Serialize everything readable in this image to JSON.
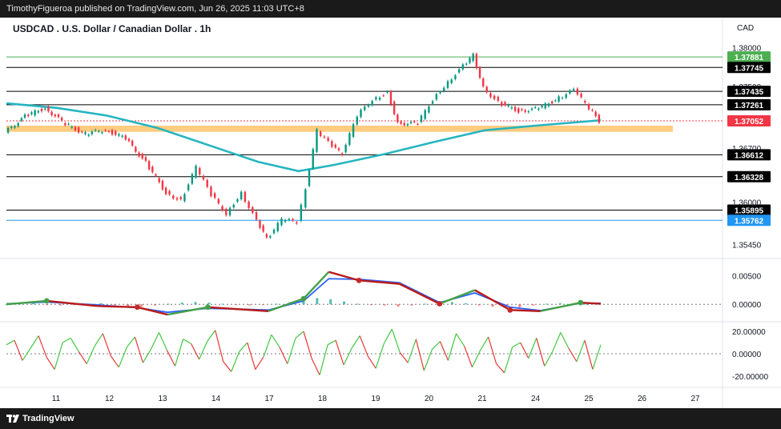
{
  "header": {
    "publisher_line": "TimothyFigueroa published on TradingView.com, Jun 26, 2025 11:03 UTC+8"
  },
  "footer": {
    "brand": "TradingView",
    "logo_icon": "tradingview-logo-icon"
  },
  "chart_data": {
    "type": "line",
    "title": "USDCAD . U.S. Dollar / Canadian Dollar . 1h",
    "currency": "CAD",
    "x_ticks": [
      "11",
      "12",
      "13",
      "14",
      "17",
      "18",
      "19",
      "20",
      "21",
      "24",
      "25",
      "26",
      "27"
    ],
    "price_axis": {
      "ticks": [
        "1.38000",
        "1.37500",
        "1.36700",
        "1.36000",
        "1.35450"
      ],
      "ylim": [
        1.3536,
        1.3808
      ]
    },
    "levels": [
      {
        "label": "1.37881",
        "value": 1.37881,
        "color": "#4caf50"
      },
      {
        "label": "1.37745",
        "value": 1.37745,
        "color": "#000000"
      },
      {
        "label": "1.37435",
        "value": 1.37435,
        "color": "#000000"
      },
      {
        "label": "1.37261",
        "value": 1.37261,
        "color": "#000000"
      },
      {
        "label": "1.37052",
        "value": 1.37052,
        "color": "#f23645"
      },
      {
        "label": "1.36612",
        "value": 1.36612,
        "color": "#000000"
      },
      {
        "label": "1.36328",
        "value": 1.36328,
        "color": "#000000"
      },
      {
        "label": "1.35895",
        "value": 1.35895,
        "color": "#000000"
      },
      {
        "label": "1.35762",
        "value": 1.35762,
        "color": "#2196f3"
      }
    ],
    "zone": {
      "from": 1.3691,
      "to": 1.3699,
      "color": "#ffcc80"
    },
    "price_series": [
      {
        "x": 0,
        "y": 1.369
      },
      {
        "x": 8,
        "y": 1.3711
      },
      {
        "x": 16,
        "y": 1.3722
      },
      {
        "x": 24,
        "y": 1.3701
      },
      {
        "x": 32,
        "y": 1.3688
      },
      {
        "x": 40,
        "y": 1.3694
      },
      {
        "x": 48,
        "y": 1.3682
      },
      {
        "x": 56,
        "y": 1.3651
      },
      {
        "x": 64,
        "y": 1.3612
      },
      {
        "x": 70,
        "y": 1.3602
      },
      {
        "x": 76,
        "y": 1.3645
      },
      {
        "x": 82,
        "y": 1.3609
      },
      {
        "x": 88,
        "y": 1.3585
      },
      {
        "x": 94,
        "y": 1.3612
      },
      {
        "x": 100,
        "y": 1.3575
      },
      {
        "x": 104,
        "y": 1.3552
      },
      {
        "x": 110,
        "y": 1.3577
      },
      {
        "x": 116,
        "y": 1.3574
      },
      {
        "x": 118,
        "y": 1.3594
      },
      {
        "x": 124,
        "y": 1.3692
      },
      {
        "x": 130,
        "y": 1.3672
      },
      {
        "x": 134,
        "y": 1.3662
      },
      {
        "x": 140,
        "y": 1.3712
      },
      {
        "x": 146,
        "y": 1.3733
      },
      {
        "x": 152,
        "y": 1.3742
      },
      {
        "x": 156,
        "y": 1.3702
      },
      {
        "x": 164,
        "y": 1.3702
      },
      {
        "x": 170,
        "y": 1.3733
      },
      {
        "x": 176,
        "y": 1.3756
      },
      {
        "x": 182,
        "y": 1.3776
      },
      {
        "x": 186,
        "y": 1.379
      },
      {
        "x": 190,
        "y": 1.3748
      },
      {
        "x": 196,
        "y": 1.3729
      },
      {
        "x": 204,
        "y": 1.3718
      },
      {
        "x": 212,
        "y": 1.3721
      },
      {
        "x": 220,
        "y": 1.3735
      },
      {
        "x": 226,
        "y": 1.3745
      },
      {
        "x": 232,
        "y": 1.3722
      },
      {
        "x": 236,
        "y": 1.3705
      }
    ],
    "moving_average": [
      {
        "x": 0,
        "y": 1.3728
      },
      {
        "x": 20,
        "y": 1.3722
      },
      {
        "x": 40,
        "y": 1.3712
      },
      {
        "x": 60,
        "y": 1.3696
      },
      {
        "x": 80,
        "y": 1.3674
      },
      {
        "x": 100,
        "y": 1.3652
      },
      {
        "x": 116,
        "y": 1.364
      },
      {
        "x": 130,
        "y": 1.3648
      },
      {
        "x": 150,
        "y": 1.3662
      },
      {
        "x": 170,
        "y": 1.3678
      },
      {
        "x": 190,
        "y": 1.3693
      },
      {
        "x": 210,
        "y": 1.3699
      },
      {
        "x": 236,
        "y": 1.3706
      }
    ],
    "macd_panel": {
      "ticks": [
        "0.00500",
        "0.00000"
      ],
      "ylim": [
        -0.0025,
        0.0065
      ],
      "macd": [
        {
          "x": 0,
          "y": 0.0
        },
        {
          "x": 16,
          "y": 0.0006
        },
        {
          "x": 36,
          "y": -0.0003
        },
        {
          "x": 52,
          "y": -0.0005
        },
        {
          "x": 64,
          "y": -0.0018
        },
        {
          "x": 80,
          "y": -0.0005
        },
        {
          "x": 104,
          "y": -0.0012
        },
        {
          "x": 118,
          "y": 0.001
        },
        {
          "x": 128,
          "y": 0.0057
        },
        {
          "x": 140,
          "y": 0.0042
        },
        {
          "x": 156,
          "y": 0.0036
        },
        {
          "x": 172,
          "y": 0.0001
        },
        {
          "x": 186,
          "y": 0.0025
        },
        {
          "x": 200,
          "y": -0.001
        },
        {
          "x": 212,
          "y": -0.0012
        },
        {
          "x": 228,
          "y": 0.0003
        },
        {
          "x": 236,
          "y": 0.0001
        }
      ],
      "signal": [
        {
          "x": 0,
          "y": 0.0001
        },
        {
          "x": 16,
          "y": 0.0004
        },
        {
          "x": 36,
          "y": -0.0001
        },
        {
          "x": 52,
          "y": -0.0006
        },
        {
          "x": 64,
          "y": -0.0014
        },
        {
          "x": 80,
          "y": -0.0007
        },
        {
          "x": 104,
          "y": -0.001
        },
        {
          "x": 118,
          "y": 0.0006
        },
        {
          "x": 128,
          "y": 0.0045
        },
        {
          "x": 140,
          "y": 0.0044
        },
        {
          "x": 156,
          "y": 0.0038
        },
        {
          "x": 172,
          "y": 0.0003
        },
        {
          "x": 186,
          "y": 0.002
        },
        {
          "x": 200,
          "y": -0.0005
        },
        {
          "x": 212,
          "y": -0.0011
        },
        {
          "x": 228,
          "y": 0.0002
        },
        {
          "x": 236,
          "y": 0.0002
        }
      ],
      "histogram": [
        0.0,
        0.0001,
        0.0002,
        -0.0001,
        -0.0002,
        -0.0001,
        0.0001,
        0.0002,
        -0.0001,
        -0.0003,
        -0.0004,
        -0.0002,
        0.0001,
        0.0003,
        0.0004,
        0.0003,
        0.0001,
        -0.0001,
        -0.0002,
        -0.0001,
        0.0001,
        0.0004,
        0.0008,
        0.0011,
        0.0009,
        0.0005,
        0.0001,
        -0.0001,
        -0.0002,
        -0.0004,
        -0.0002,
        0.0001,
        0.0003,
        0.0004,
        0.0002,
        -0.0002,
        -0.0004,
        -0.0006,
        -0.0005,
        -0.0002,
        0.0001,
        0.0002,
        0.0001,
        0.0
      ]
    },
    "osc_panel": {
      "ticks": [
        "20.00000",
        "0.00000",
        "-20.00000"
      ],
      "ylim": [
        -25,
        25
      ],
      "values": [
        8,
        12,
        -6,
        5,
        16,
        -3,
        -14,
        10,
        14,
        2,
        -9,
        7,
        18,
        -2,
        -12,
        6,
        15,
        -8,
        4,
        19,
        3,
        -11,
        13,
        9,
        -5,
        11,
        21,
        -7,
        -16,
        2,
        10,
        -14,
        -3,
        17,
        6,
        -9,
        14,
        20,
        -4,
        -19,
        8,
        12,
        -10,
        5,
        16,
        -2,
        -13,
        9,
        22,
        1,
        -8,
        13,
        -15,
        4,
        11,
        -6,
        18,
        7,
        -12,
        3,
        15,
        -9,
        -17,
        6,
        10,
        -4,
        14,
        -11,
        2,
        19,
        5,
        -7,
        12,
        -14,
        8
      ]
    }
  }
}
